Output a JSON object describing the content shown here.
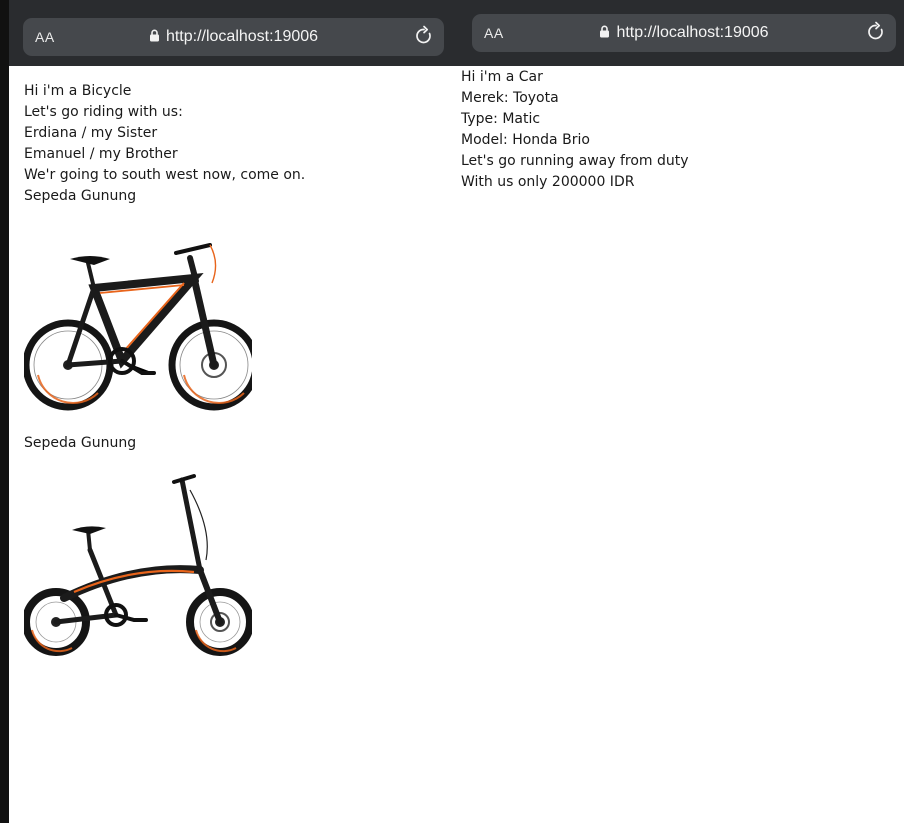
{
  "left_window": {
    "aa_label": "AA",
    "url": "http://localhost:19006",
    "icons": {
      "lock": "lock-icon",
      "reload": "reload-icon"
    },
    "lines": [
      "Hi i'm a Bicycle",
      "Let's go riding with us:",
      "Erdiana / my Sister",
      "Emanuel / my Brother",
      "We'r going to south west now, come on."
    ],
    "bikes": [
      {
        "caption": "Sepeda Gunung",
        "image": "mountain-bike-image"
      },
      {
        "caption": "Sepeda Gunung",
        "image": "folding-bike-image"
      }
    ]
  },
  "right_window": {
    "aa_label": "AA",
    "url": "http://localhost:19006",
    "icons": {
      "lock": "lock-icon",
      "reload": "reload-icon"
    },
    "lines": [
      "Hi i'm a Car",
      "Merek: Toyota",
      "Type: Matic",
      "Model: Honda Brio",
      "Let's go running away from duty",
      "With us only 200000 IDR"
    ]
  },
  "colors": {
    "toolbar_bg": "#2a2c2f",
    "urlbar_bg": "#45484c",
    "bike_frame": "#1b1b1b",
    "bike_accent": "#e8641b"
  }
}
